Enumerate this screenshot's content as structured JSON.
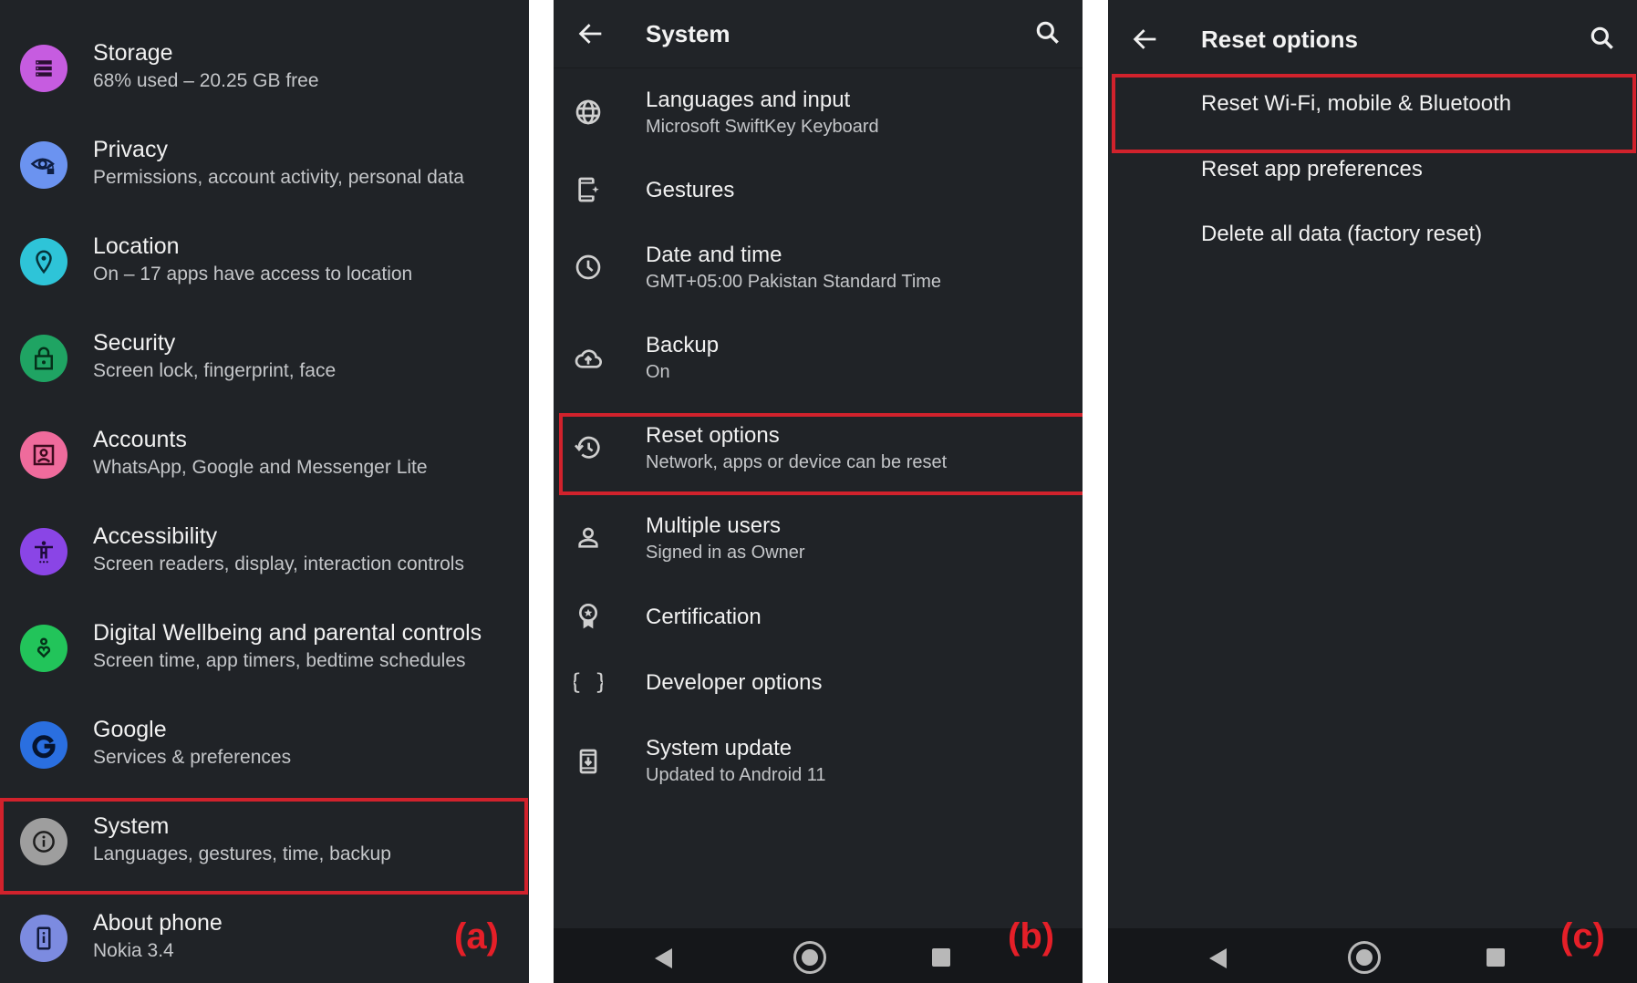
{
  "colors": {
    "background": "#202327",
    "highlight": "#d1222c",
    "panel_label": "#e51f28"
  },
  "panel_a": {
    "label": "(a)",
    "items": [
      {
        "title": "Storage",
        "subtitle": "68% used – 20.25 GB free",
        "icon": "storage-icon",
        "color": "#c65ce0"
      },
      {
        "title": "Privacy",
        "subtitle": "Permissions, account activity, personal data",
        "icon": "privacy-eye-icon",
        "color": "#6b93f0"
      },
      {
        "title": "Location",
        "subtitle": "On – 17 apps have access to location",
        "icon": "location-pin-icon",
        "color": "#2ec4d8"
      },
      {
        "title": "Security",
        "subtitle": "Screen lock, fingerprint, face",
        "icon": "lock-icon",
        "color": "#1fa463"
      },
      {
        "title": "Accounts",
        "subtitle": "WhatsApp, Google and Messenger Lite",
        "icon": "account-box-icon",
        "color": "#ef6b9c"
      },
      {
        "title": "Accessibility",
        "subtitle": "Screen readers, display, interaction controls",
        "icon": "accessibility-icon",
        "color": "#8a45e6"
      },
      {
        "title": "Digital Wellbeing and parental controls",
        "subtitle": "Screen time, app timers, bedtime schedules",
        "icon": "wellbeing-icon",
        "color": "#22c45a"
      },
      {
        "title": "Google",
        "subtitle": "Services & preferences",
        "icon": "google-icon",
        "color": "#2a6fe0"
      },
      {
        "title": "System",
        "subtitle": "Languages, gestures, time, backup",
        "icon": "info-icon",
        "color": "#9e9e9e"
      },
      {
        "title": "About phone",
        "subtitle": "Nokia 3.4",
        "icon": "phone-info-icon",
        "color": "#7c8be0"
      }
    ]
  },
  "panel_b": {
    "label": "(b)",
    "title": "System",
    "items": [
      {
        "title": "Languages and input",
        "subtitle": "Microsoft SwiftKey Keyboard",
        "icon": "globe-icon"
      },
      {
        "title": "Gestures",
        "subtitle": "",
        "icon": "gestures-phone-icon"
      },
      {
        "title": "Date and time",
        "subtitle": "GMT+05:00 Pakistan Standard Time",
        "icon": "clock-icon"
      },
      {
        "title": "Backup",
        "subtitle": "On",
        "icon": "cloud-upload-icon"
      },
      {
        "title": "Reset options",
        "subtitle": "Network, apps or device can be reset",
        "icon": "history-icon"
      },
      {
        "title": "Multiple users",
        "subtitle": "Signed in as Owner",
        "icon": "person-icon"
      },
      {
        "title": "Certification",
        "subtitle": "",
        "icon": "badge-icon"
      },
      {
        "title": "Developer options",
        "subtitle": "",
        "icon": "braces-icon"
      },
      {
        "title": "System update",
        "subtitle": "Updated to Android 11",
        "icon": "system-update-icon"
      }
    ]
  },
  "panel_c": {
    "label": "(c)",
    "title": "Reset options",
    "items": [
      {
        "title": "Reset Wi-Fi, mobile & Bluetooth"
      },
      {
        "title": "Reset app preferences"
      },
      {
        "title": "Delete all data (factory reset)"
      }
    ]
  }
}
